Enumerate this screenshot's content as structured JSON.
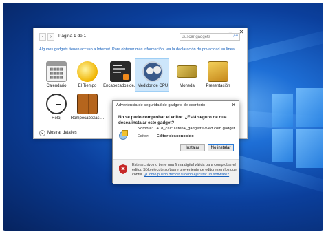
{
  "gallery": {
    "page_label": "Página 1 de 1",
    "search_placeholder": "Buscar gadgets",
    "info_text": "Algunos gadgets tienen acceso a Internet. Para obtener más información, lea la declaración de privacidad en línea.",
    "gadgets": [
      {
        "label": "Calendario",
        "icon": "calendar-icon"
      },
      {
        "label": "El Tiempo",
        "icon": "weather-icon"
      },
      {
        "label": "Encabezados de...",
        "icon": "headlines-icon"
      },
      {
        "label": "Medidor de CPU",
        "icon": "cpu-meter-icon"
      },
      {
        "label": "Moneda",
        "icon": "currency-icon"
      },
      {
        "label": "Presentación",
        "icon": "slideshow-icon"
      },
      {
        "label": "Reloj",
        "icon": "clock-icon"
      },
      {
        "label": "Rompecabezas ...",
        "icon": "puzzle-icon"
      }
    ],
    "more_details": "Mostrar detalles"
  },
  "dialog": {
    "title": "Advertencia de seguridad de gadgets de escritorio",
    "question": "No se pudo comprobar el editor. ¿Está seguro de que desea instalar este gadget?",
    "name_label": "Nombre:",
    "name_value": "418_calculaton4_gadgetrevived.com.gadget",
    "editor_label": "Editor:",
    "editor_value": "Editor desconocido",
    "install_button": "Instalar",
    "no_install_button": "No instalar",
    "warning_text": "Este archivo no tiene una firma digital válida para comprobar el editor. Sólo ejecute software proveniente de editores en los que confía.",
    "warning_link": "¿Cómo puedo decidir si debo ejecutar un software?"
  },
  "colors": {
    "accent": "#1560bd",
    "selection": "#cde6fb"
  }
}
